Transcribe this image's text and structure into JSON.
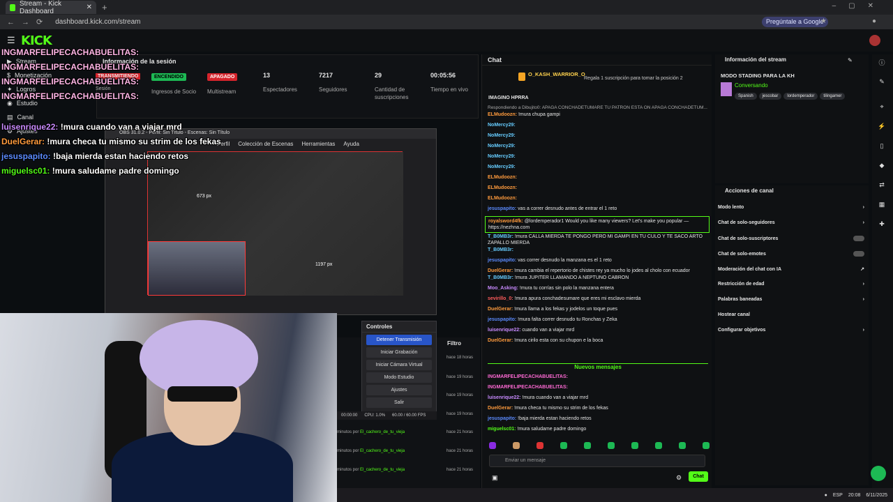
{
  "browser": {
    "tab_title": "Stream - Kick Dashboard",
    "url": "dashboard.kick.com/stream",
    "gemini": "Pregúntale a Google"
  },
  "sidebar": [
    "Stream",
    "Monetización",
    "Logros",
    "Estudio",
    "Canal",
    "Ajustes"
  ],
  "session": {
    "title": "Información de la sesión",
    "stats": [
      {
        "value": "ENCENDIDO",
        "label": "Ingresos de Socio",
        "badge_color": "#1db954"
      },
      {
        "value": "APAGADO",
        "label": "Multistream",
        "badge_color": "#d6242c"
      },
      {
        "value": "13",
        "label": "Espectadores"
      },
      {
        "value": "7217",
        "label": "Seguidores"
      },
      {
        "value": "29",
        "label": "Cantidad de suscripciones"
      },
      {
        "value": "00:05:56",
        "label": "Tiempo en vivo"
      }
    ],
    "live_badge": "TRANSMITIENDO",
    "sesion": "Sesión"
  },
  "overlay_chat": [
    {
      "user": "INGMARFELIPECACHABUELITAS:",
      "text": ""
    },
    {
      "user": "INGMARFELIPECACHABUELITAS:",
      "text": ""
    },
    {
      "user": "INGMARFELIPECACHABUELITAS:",
      "text": ""
    },
    {
      "user": "INGMARFELIPECACHABUELITAS:",
      "text": ""
    },
    {
      "user": "luisenrique22:",
      "text": "!mura cuando van a viajar mrd"
    },
    {
      "user": "DuelGerar:",
      "text": "!mura checa tu mismo su strim de los fekas"
    },
    {
      "user": "jesuspapito:",
      "text": "!baja mierda estan haciendo retos"
    },
    {
      "user": "miguelsc01:",
      "text": "!mura saludame padre domingo"
    }
  ],
  "obs": {
    "title": "OBS 31.0.2 - Perfil: Sin Título - Escenas: Sin Título",
    "menu": [
      "Perfil",
      "Colección de Escenas",
      "Herramientas",
      "Ayuda"
    ],
    "px1": "673 px",
    "px2": "1197 px",
    "controls_title": "Controles",
    "buttons": [
      "Detener Transmisión",
      "Iniciar Grabación",
      "Iniciar Cámara Virtual",
      "Modo Estudio",
      "Ajustes",
      "Salir"
    ],
    "status": [
      "00:00:00",
      "CPU: 1.0%",
      "60.00 / 60.00 FPS"
    ]
  },
  "filtro": {
    "title": "Filtro",
    "rows": [
      {
        "text": "",
        "time": "hace 18 horas"
      },
      {
        "text": "",
        "time": "hace 19 horas"
      },
      {
        "text": "",
        "time": "hace 19 horas"
      },
      {
        "text": "",
        "time": "hace 19 horas"
      },
      {
        "text": "minutos por ",
        "user": "El_cachero_de_tu_vieja",
        "time": "hace 21 horas"
      },
      {
        "text": "minutos por ",
        "user": "El_cachero_de_tu_vieja",
        "time": "hace 21 horas"
      },
      {
        "text": "minutos por ",
        "user": "El_cachero_de_tu_vieja",
        "time": "hace 21 horas"
      }
    ]
  },
  "chat": {
    "title": "Chat",
    "pinned_user": "O_KASH_WARRIOR_O",
    "pinned_text": "Regala 1 suscripción para tomar la posición 2",
    "top_msg": "IMAGINO HPRRA",
    "reply": "Respondiendo a Dibujito0: APAGA CONCHADETUMARE TU PATRÓN ESTA ON APAGA CONCHADETUM...",
    "messages": [
      {
        "user": "ELMudoozn:",
        "color": "#ff9b3d",
        "text": "!mura chupa gampi"
      },
      {
        "user": "NoMercy29:",
        "color": "#6cf",
        "text": ""
      },
      {
        "user": "NoMercy29:",
        "color": "#6cf",
        "text": ""
      },
      {
        "user": "NoMercy29:",
        "color": "#6cf",
        "text": ""
      },
      {
        "user": "NoMercy29:",
        "color": "#6cf",
        "text": ""
      },
      {
        "user": "NoMercy29:",
        "color": "#6cf",
        "text": ""
      },
      {
        "user": "ELMudoozn:",
        "color": "#ff9b3d",
        "text": ""
      },
      {
        "user": "ELMudoozn:",
        "color": "#ff9b3d",
        "text": ""
      },
      {
        "user": "ELMudoozn:",
        "color": "#ff9b3d",
        "text": ""
      },
      {
        "user": "jesuspapito:",
        "color": "#5b8bff",
        "text": "vas a correr desnudo antes de entrar el 1 reto"
      },
      {
        "user": "royalsword4fk:",
        "color": "#ff9b3d",
        "text": "@lordemperador1 Would you like many viewers? Let's make you popular — https://nezhna.com",
        "hl": true
      },
      {
        "user": "T_B0MB3r:",
        "color": "#6cf",
        "text": "!mura CALLA MIERDA TE PONGO PERO MI GAMPI EN TU CULO Y TE SACO ARTO ZAPALLO MIERDA"
      },
      {
        "user": "T_B0MB3r:",
        "color": "#6cf",
        "text": ""
      },
      {
        "user": "jesuspapito:",
        "color": "#5b8bff",
        "text": "vas correr desnudo la manzana es el 1 reto"
      },
      {
        "user": "DuelGerar:",
        "color": "#ff9b3d",
        "text": "!mura cambia el repertorio de chistes rey ya mucho lo jodes al cholo con ecuador"
      },
      {
        "user": "T_B0MB3r:",
        "color": "#6cf",
        "text": "!mura JUPITER LLAMANDO A NEPTUNO CABRON"
      },
      {
        "user": "Moo_Asking:",
        "color": "#c98bff",
        "text": "!mura tu corrías sin polo la manzana entera"
      },
      {
        "user": "sevirillo_0:",
        "color": "#ff5c5c",
        "text": "!mura apura conchadesumare que eres mi esclavo mierda"
      },
      {
        "user": "DuelGerar:",
        "color": "#ff9b3d",
        "text": "!mura llama a los fekas y jodelos un toque pues"
      },
      {
        "user": "jesuspapito:",
        "color": "#5b8bff",
        "text": "!mura falta correr desnudo tu Ronchas y Zeka"
      },
      {
        "user": "luisenrique22:",
        "color": "#c98bff",
        "text": "cuando van a viajar mrd"
      },
      {
        "user": "DuelGerar:",
        "color": "#ff9b3d",
        "text": "!mura cirilo esta con su chupon e la boca"
      }
    ],
    "nuevos": "Nuevos mensajes",
    "new_messages": [
      {
        "user": "INGMARFELIPECACHABUELITAS:",
        "color": "#ff6ad5",
        "text": ""
      },
      {
        "user": "INGMARFELIPECACHABUELITAS:",
        "color": "#ff6ad5",
        "text": ""
      },
      {
        "user": "luisenrique22:",
        "color": "#c98bff",
        "text": "!mura cuando van a viajar mrd"
      },
      {
        "user": "DuelGerar:",
        "color": "#ff9b3d",
        "text": "!mura checa tu mismo su strim de los fekas"
      },
      {
        "user": "jesuspapito:",
        "color": "#5b8bff",
        "text": "!baja mierda estan haciendo retos"
      },
      {
        "user": "miguelsc01:",
        "color": "#53fc18",
        "text": "!mura saludame padre domingo"
      }
    ],
    "placeholder": "Enviar un mensaje",
    "send": "Chat"
  },
  "stream_info": {
    "title": "Información del stream",
    "name": "MODO STADING PARA LA KH",
    "category": "Conversando",
    "tags": [
      "Spanish",
      "jescobar",
      "lordemperador",
      "tilingamer"
    ]
  },
  "actions": {
    "title": "Acciones de canal",
    "items": [
      {
        "label": "Modo lento",
        "type": "arrow"
      },
      {
        "label": "Chat de solo-seguidores",
        "type": "arrow"
      },
      {
        "label": "Chat de solo-suscriptores",
        "type": "toggle"
      },
      {
        "label": "Chat de solo-emotes",
        "type": "toggle"
      },
      {
        "label": "Moderación del chat con IA",
        "type": "ext"
      },
      {
        "label": "Restricción de edad",
        "type": "arrow"
      },
      {
        "label": "Palabras baneadas",
        "type": "arrow"
      },
      {
        "label": "Hostear canal",
        "type": "none"
      },
      {
        "label": "Configurar objetivos",
        "type": "arrow"
      }
    ]
  },
  "taskbar": {
    "lang": "ESP",
    "time": "20:08",
    "date": "6/11/2025"
  },
  "colors": {
    "accent": "#53fc18"
  }
}
